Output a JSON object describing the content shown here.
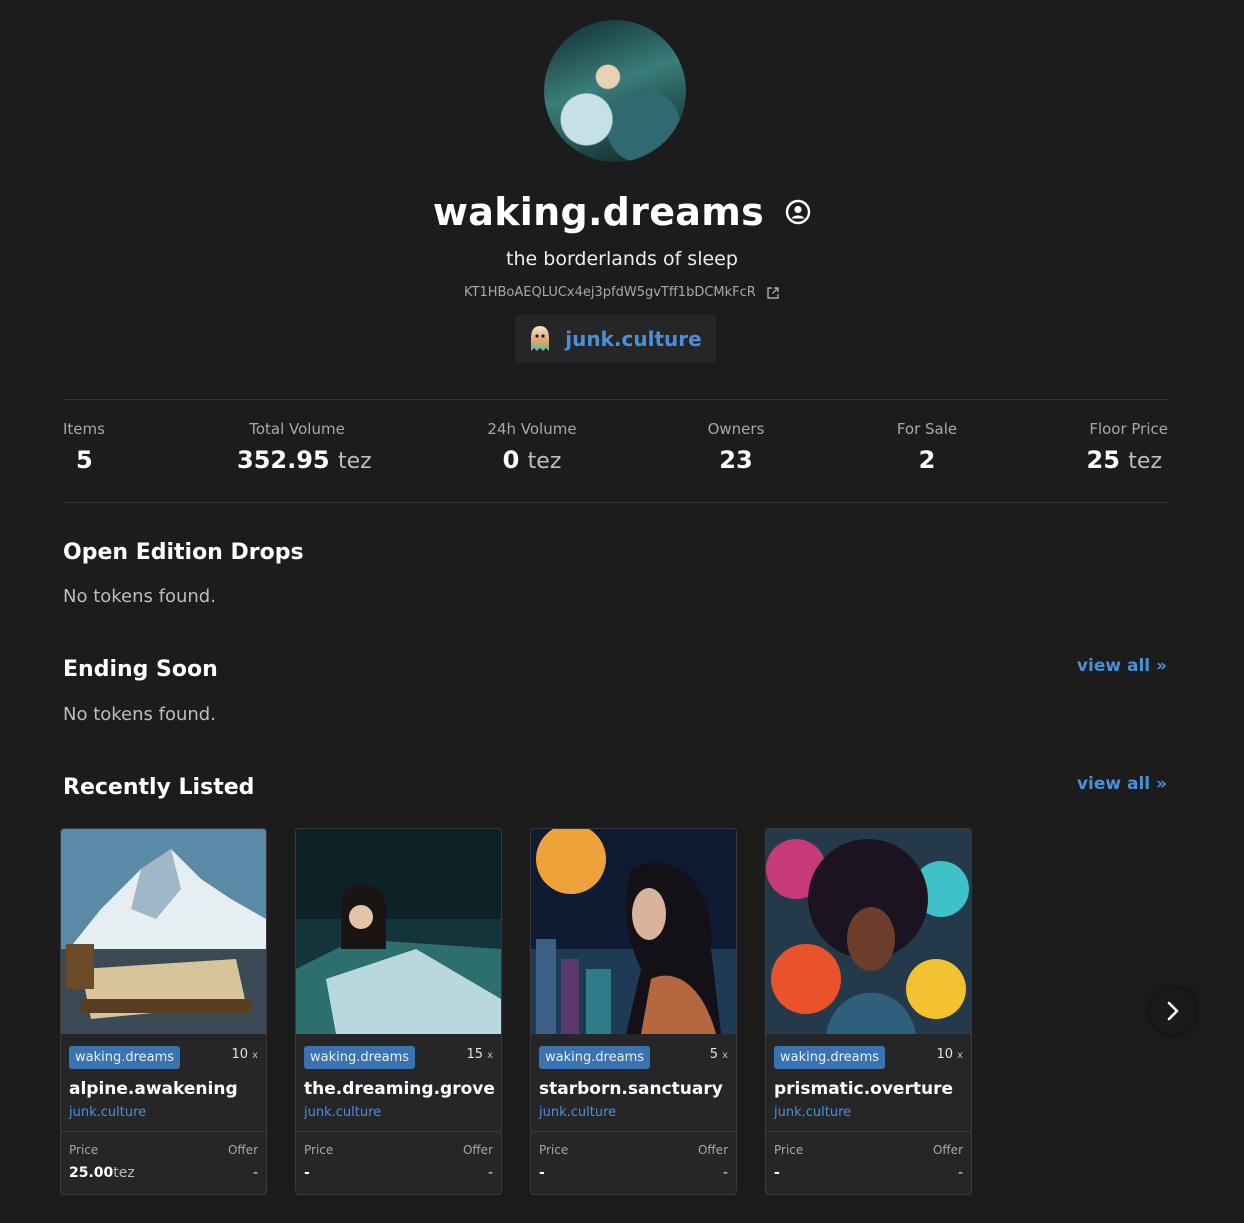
{
  "collection": {
    "name": "waking.dreams",
    "description": "the borderlands of sleep",
    "address": "KT1HBoAEQLUCx4ej3pfdW5gvTff1bDCMkFcR",
    "creator": "junk.culture"
  },
  "stats": [
    {
      "label": "Items",
      "value": "5",
      "unit": ""
    },
    {
      "label": "Total Volume",
      "value": "352.95",
      "unit": "tez"
    },
    {
      "label": "24h Volume",
      "value": "0",
      "unit": "tez"
    },
    {
      "label": "Owners",
      "value": "23",
      "unit": ""
    },
    {
      "label": "For Sale",
      "value": "2",
      "unit": ""
    },
    {
      "label": "Floor Price",
      "value": "25",
      "unit": "tez"
    }
  ],
  "sections": {
    "open_edition": {
      "title": "Open Edition Drops",
      "empty": "No tokens found."
    },
    "ending_soon": {
      "title": "Ending Soon",
      "empty": "No tokens found.",
      "view_all": "view all »"
    },
    "recently_listed": {
      "title": "Recently Listed",
      "view_all": "view all »"
    }
  },
  "cards": [
    {
      "collection": "waking.dreams",
      "editions": "10",
      "name": "alpine.awakening",
      "creator": "junk.culture",
      "price_label": "Price",
      "offer_label": "Offer",
      "price": "25.00",
      "price_unit": "tez",
      "offer": "-"
    },
    {
      "collection": "waking.dreams",
      "editions": "15",
      "name": "the.dreaming.grove",
      "creator": "junk.culture",
      "price_label": "Price",
      "offer_label": "Offer",
      "price": "-",
      "price_unit": "",
      "offer": "-"
    },
    {
      "collection": "waking.dreams",
      "editions": "5",
      "name": "starborn.sanctuary",
      "creator": "junk.culture",
      "price_label": "Price",
      "offer_label": "Offer",
      "price": "-",
      "price_unit": "",
      "offer": "-"
    },
    {
      "collection": "waking.dreams",
      "editions": "10",
      "name": "prismatic.overture",
      "creator": "junk.culture",
      "price_label": "Price",
      "offer_label": "Offer",
      "price": "-",
      "price_unit": "",
      "offer": "-"
    }
  ],
  "edition_suffix": "x",
  "icons": {
    "verified": "user-circle-icon",
    "external": "external-link-icon",
    "creator_avatar": "ghost-avatar-icon",
    "next": "chevron-right-icon"
  },
  "colors": {
    "accent": "#4a90d9",
    "tag": "#3b73b0",
    "background": "#1c1c1d"
  }
}
